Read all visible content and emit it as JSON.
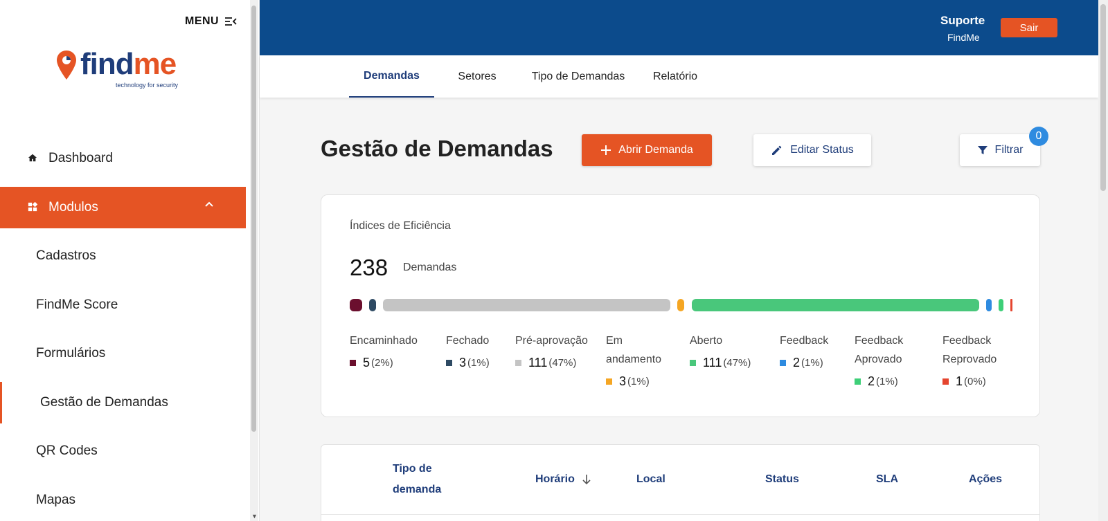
{
  "sidebar": {
    "menu_label": "MENU",
    "logo": {
      "brand": "findme",
      "brand_main": "find",
      "brand_accent": "me",
      "tagline": "technology for security"
    },
    "items": [
      {
        "label": "Dashboard",
        "icon": "home-icon"
      },
      {
        "label": "Modulos",
        "icon": "grid-icon",
        "expanded": true
      },
      {
        "label": "Cadastros"
      },
      {
        "label": "FindMe Score"
      },
      {
        "label": "Formulários"
      },
      {
        "label": "Gestão de Demandas",
        "selected": true
      },
      {
        "label": "QR Codes"
      },
      {
        "label": "Mapas"
      }
    ]
  },
  "topbar": {
    "user_name": "Suporte",
    "user_org": "FindMe",
    "logout_label": "Sair"
  },
  "tabs": [
    "Demandas",
    "Setores",
    "Tipo de Demandas",
    "Relatório"
  ],
  "header": {
    "title": "Gestão de Demandas",
    "open_demand_label": "Abrir Demanda",
    "edit_status_label": "Editar Status",
    "filter_label": "Filtrar",
    "filter_count": "0"
  },
  "efficiency": {
    "title": "Índices de Eficiência",
    "total": "238",
    "total_label": "Demandas",
    "statuses": [
      {
        "label": "Encaminhado",
        "count": "5",
        "pct": "(2%)",
        "color": "#6b0f2e"
      },
      {
        "label": "Fechado",
        "count": "3",
        "pct": "(1%)",
        "color": "#2e4a63"
      },
      {
        "label": "Pré-aprovação",
        "count": "111",
        "pct": "(47%)",
        "color": "#c4c4c4"
      },
      {
        "label": "Em andamento",
        "count": "3",
        "pct": "(1%)",
        "color": "#f5a623"
      },
      {
        "label": "Aberto",
        "count": "111",
        "pct": "(47%)",
        "color": "#49c77b"
      },
      {
        "label": "Feedback",
        "count": "2",
        "pct": "(1%)",
        "color": "#2e8be0"
      },
      {
        "label": "Feedback Aprovado",
        "count": "2",
        "pct": "(1%)",
        "color": "#3ecf78"
      },
      {
        "label": "Feedback Reprovado",
        "count": "1",
        "pct": "(0%)",
        "color": "#e5452f"
      }
    ]
  },
  "table": {
    "columns": [
      "Tipo de demanda",
      "Horário",
      "Local",
      "Status",
      "SLA",
      "Ações"
    ],
    "sort_column": "Horário",
    "sort_direction": "desc"
  },
  "colors": {
    "brand_orange": "#e55424",
    "brand_blue": "#0c4b8c",
    "nav_text": "#1f3d7a"
  }
}
